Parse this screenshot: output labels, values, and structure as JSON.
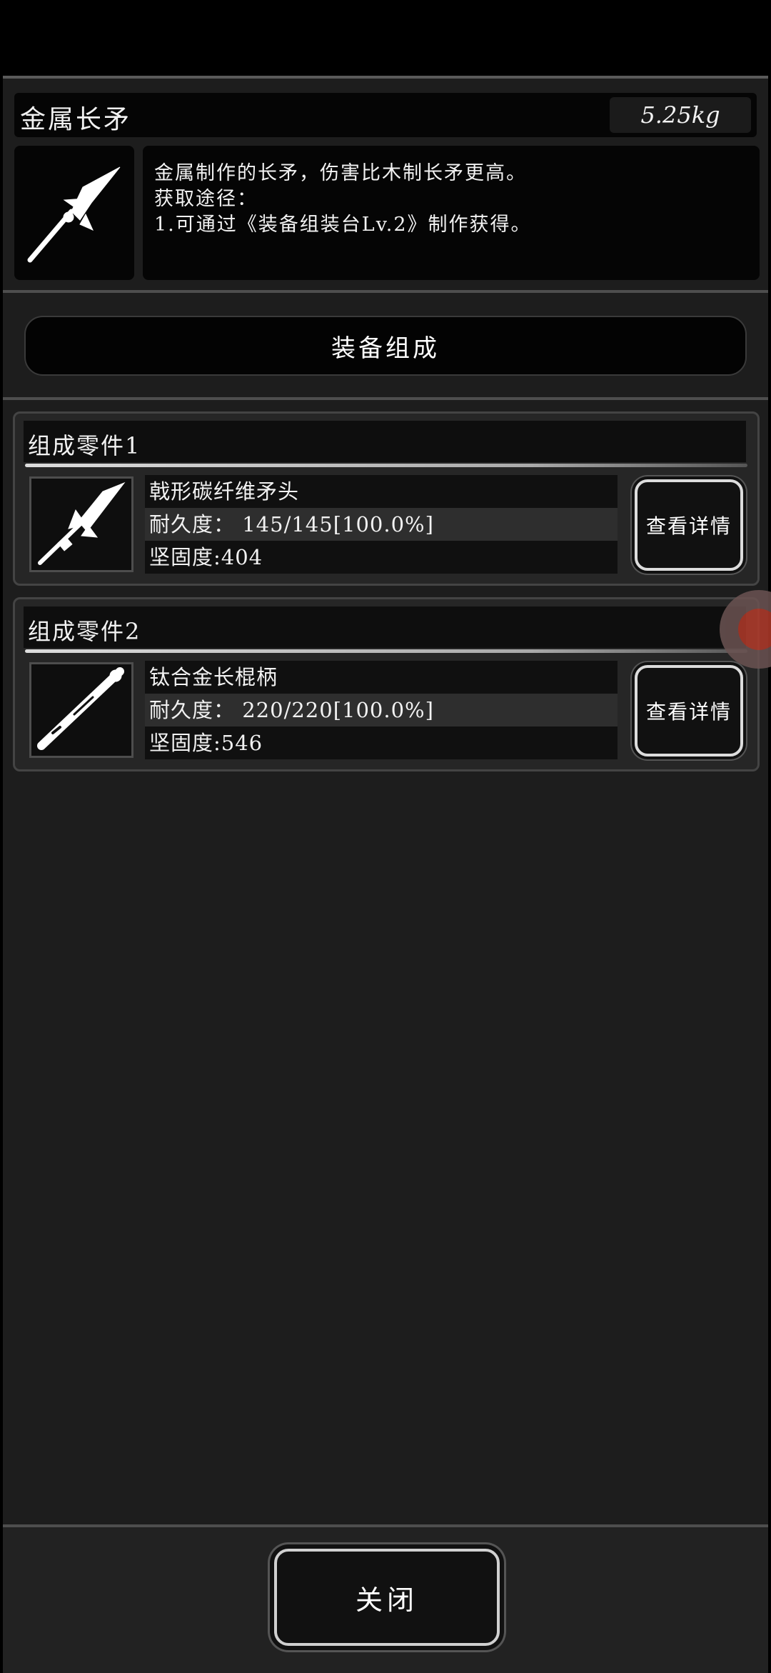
{
  "item": {
    "name": "金属长矛",
    "weight": "5.25kg",
    "description": [
      "金属制作的长矛，伤害比木制长矛更高。",
      "获取途径：",
      "1.可通过《装备组装台Lv.2》制作获得。"
    ],
    "icon": "spear-icon"
  },
  "section_button_label": "装备组成",
  "parts": [
    {
      "title": "组成零件1",
      "name": "戟形碳纤维矛头",
      "durability": "耐久度： 145/145[100.0%]",
      "hardness": "坚固度:404",
      "icon": "spearhead-icon",
      "button_label": "查看详情"
    },
    {
      "title": "组成零件2",
      "name": "钛合金长棍柄",
      "durability": "耐久度： 220/220[100.0%]",
      "hardness": "坚固度:546",
      "icon": "staff-handle-icon",
      "button_label": "查看详情"
    }
  ],
  "close_label": "关闭",
  "colors": {
    "background": "#1d1d1d",
    "panel_dark": "#050505",
    "text": "#f2f2f2",
    "float_ball": "#b23a2a"
  }
}
